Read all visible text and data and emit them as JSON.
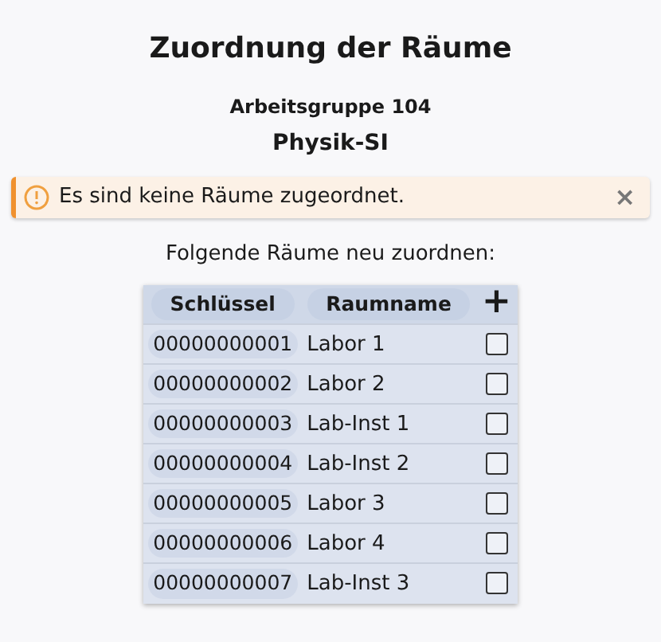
{
  "title": "Zuordnung der Räume",
  "group": "Arbeitsgruppe 104",
  "subject": "Physik-SI",
  "alert": {
    "message": "Es sind keine Räume zugeordnet.",
    "close": "×"
  },
  "prompt": "Folgende Räume neu zuordnen:",
  "table": {
    "columns": [
      "Schlüssel",
      "Raumname"
    ],
    "add": "+",
    "rows": [
      {
        "key": "00000000001",
        "name": "Labor 1",
        "checked": false
      },
      {
        "key": "00000000002",
        "name": "Labor 2",
        "checked": false
      },
      {
        "key": "00000000003",
        "name": "Lab-Inst 1",
        "checked": false
      },
      {
        "key": "00000000004",
        "name": "Lab-Inst 2",
        "checked": false
      },
      {
        "key": "00000000005",
        "name": "Labor 3",
        "checked": false
      },
      {
        "key": "00000000006",
        "name": "Labor 4",
        "checked": false
      },
      {
        "key": "00000000007",
        "name": "Lab-Inst 3",
        "checked": false
      }
    ]
  }
}
